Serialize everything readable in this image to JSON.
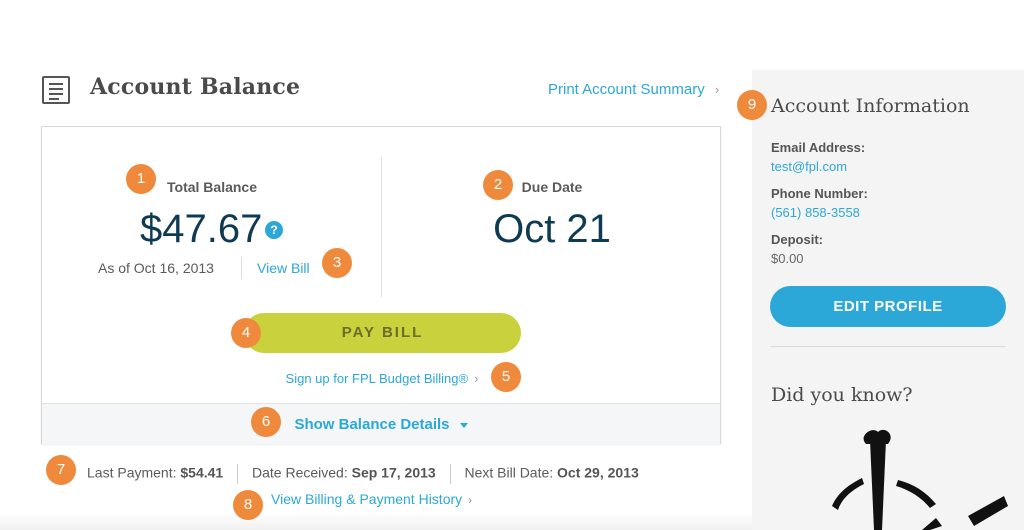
{
  "header": {
    "title": "Account Balance",
    "print_link": "Print Account Summary",
    "print_chevron": "›"
  },
  "balance": {
    "total_label": "Total Balance",
    "total_amount": "$47.67",
    "help_glyph": "?",
    "as_of": "As of Oct 16, 2013",
    "view_bill": "View Bill",
    "due_label": "Due Date",
    "due_date": "Oct 21",
    "pay_bill": "PAY BILL",
    "budget_link": "Sign up for FPL Budget Billing®",
    "budget_chevron": "›",
    "details_link": "Show Balance Details"
  },
  "payment_info": {
    "last_payment_label": "Last Payment:",
    "last_payment_value": "$54.41",
    "date_received_label": "Date Received:",
    "date_received_value": "Sep 17, 2013",
    "next_bill_label": "Next Bill Date:",
    "next_bill_value": "Oct 29, 2013",
    "history_link": "View Billing & Payment History",
    "history_chevron": "›"
  },
  "sidebar": {
    "title": "Account Information",
    "email_label": "Email Address:",
    "email_value": "test@fpl.com",
    "phone_label": "Phone Number:",
    "phone_value": "(561) 858-3558",
    "deposit_label": "Deposit:",
    "deposit_value": "$0.00",
    "edit_profile": "EDIT PROFILE",
    "did_you_know": "Did you know?"
  },
  "badges": [
    "1",
    "2",
    "3",
    "4",
    "5",
    "6",
    "7",
    "8",
    "9"
  ],
  "colors": {
    "accent_blue": "#2ba8d8",
    "pay_button": "#c9d23c",
    "badge_orange": "#ef8a3c",
    "amount_navy": "#0e3a53"
  }
}
